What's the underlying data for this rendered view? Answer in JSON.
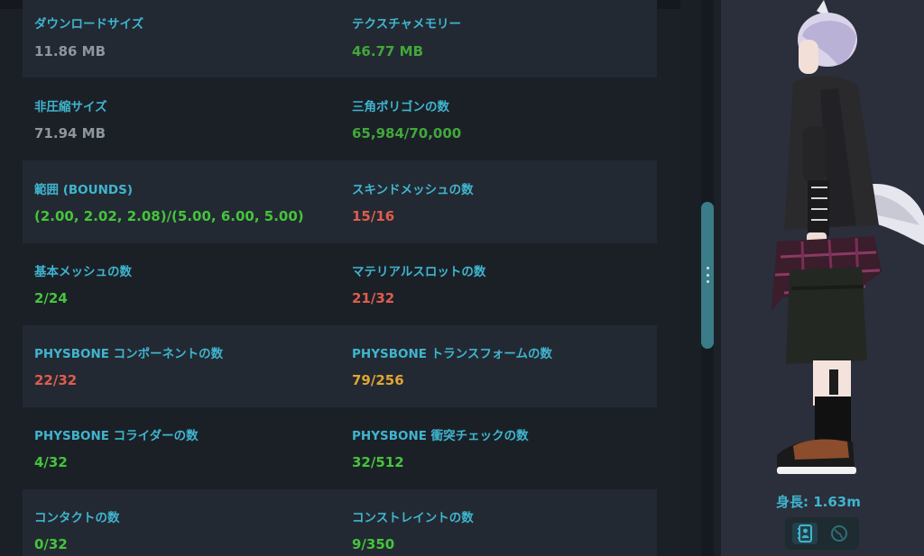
{
  "stats": [
    {
      "left": {
        "label": "ダウンロードサイズ",
        "value": "11.86 MB",
        "color": "#8d959d"
      },
      "right": {
        "label": "テクスチャメモリー",
        "value": "46.77 MB",
        "color": "#41a83a"
      }
    },
    {
      "left": {
        "label": "非圧縮サイズ",
        "value": "71.94 MB",
        "color": "#8d959d"
      },
      "right": {
        "label": "三角ポリゴンの数",
        "value": "65,984/70,000",
        "color": "#41a83a"
      }
    },
    {
      "left": {
        "label": "範囲 (BOUNDS)",
        "value": "(2.00, 2.02, 2.08)/(5.00, 6.00, 5.00)",
        "color": "#45c43c"
      },
      "right": {
        "label": "スキンドメッシュの数",
        "value": "15/16",
        "color": "#e05c4e"
      }
    },
    {
      "left": {
        "label": "基本メッシュの数",
        "value": "2/24",
        "color": "#45c43c"
      },
      "right": {
        "label": "マテリアルスロットの数",
        "value": "21/32",
        "color": "#e05c4e"
      }
    },
    {
      "left": {
        "label": "PHYSBONE コンポーネントの数",
        "value": "22/32",
        "color": "#e05c4e"
      },
      "right": {
        "label": "PHYSBONE トランスフォームの数",
        "value": "79/256",
        "color": "#e0a533"
      }
    },
    {
      "left": {
        "label": "PHYSBONE コライダーの数",
        "value": "4/32",
        "color": "#45c43c"
      },
      "right": {
        "label": "PHYSBONE 衝突チェックの数",
        "value": "32/512",
        "color": "#45c43c"
      }
    },
    {
      "left": {
        "label": "コンタクトの数",
        "value": "0/32",
        "color": "#45c43c"
      },
      "right": {
        "label": "コンストレイントの数",
        "value": "9/350",
        "color": "#45c43c"
      }
    }
  ],
  "preview": {
    "height_text": "身長: 1.63m",
    "buttons": [
      {
        "icon": "avatar-details-icon",
        "selected": true
      },
      {
        "icon": "globe-icon",
        "selected": false
      }
    ]
  },
  "colors": {
    "accent": "#3fb5cf",
    "ok": "#45c43c",
    "warn": "#e0a533",
    "bad": "#e05c4e",
    "neutral": "#8d959d"
  }
}
